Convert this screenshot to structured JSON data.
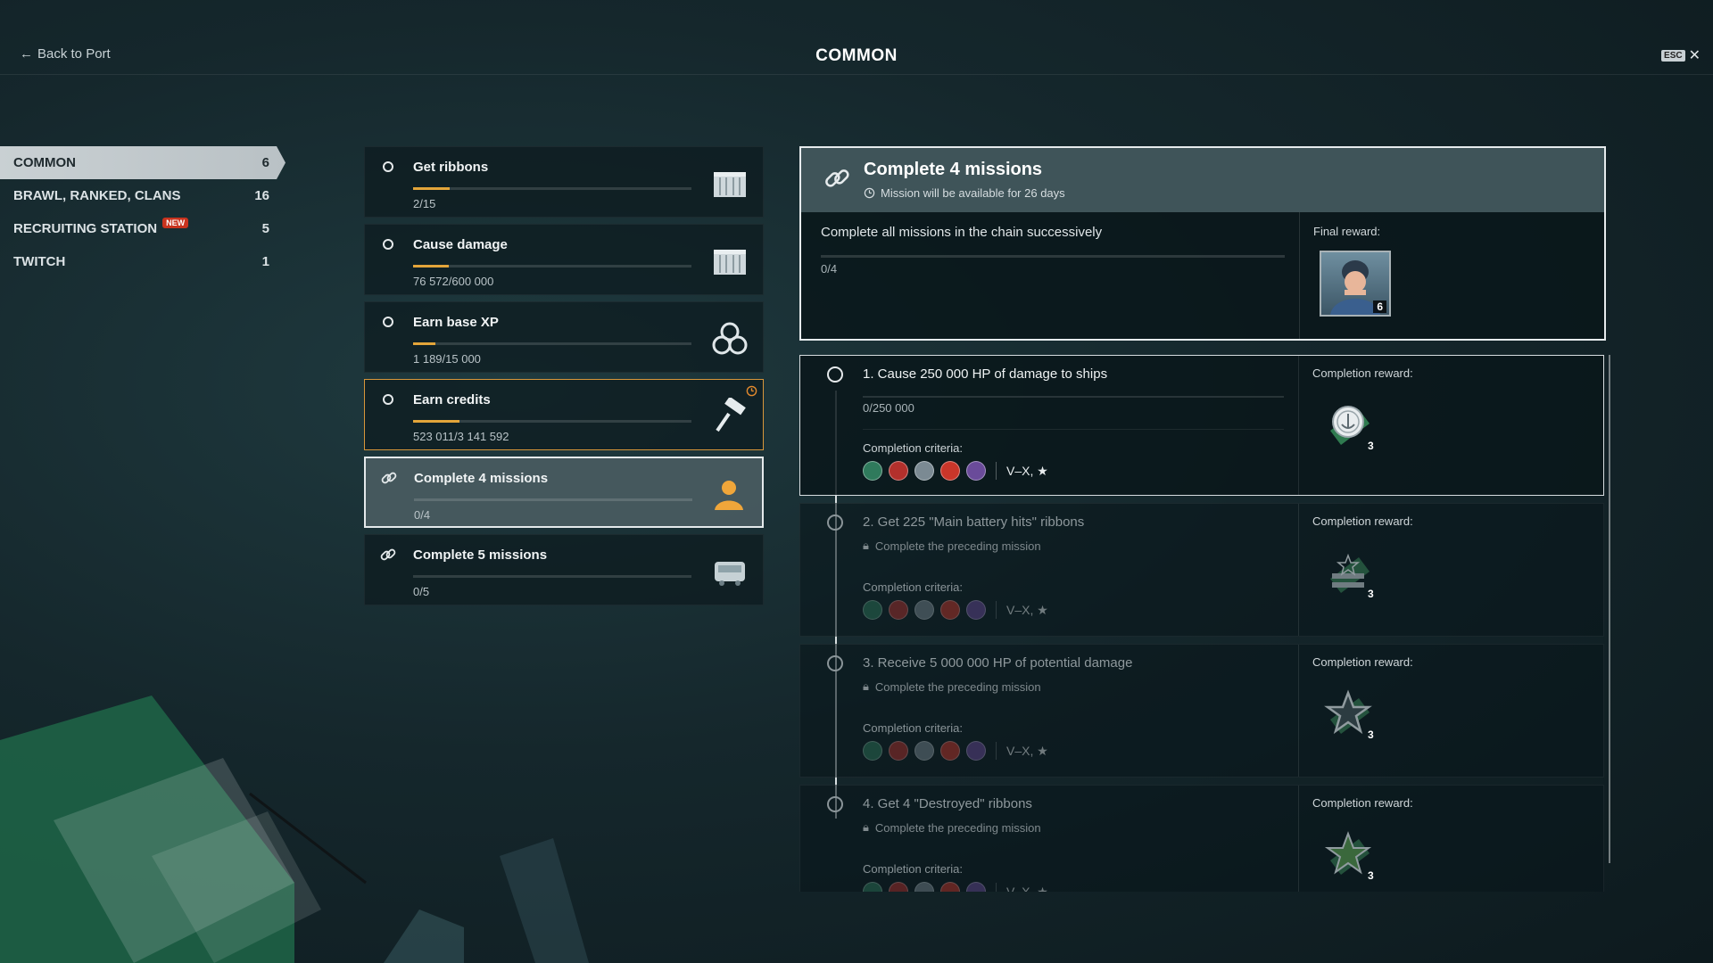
{
  "header": {
    "back_label": "Back to Port",
    "title": "COMMON",
    "esc_label": "ESC",
    "close_glyph": "✕"
  },
  "categories": [
    {
      "label": "COMMON",
      "count": "6",
      "active": true
    },
    {
      "label": "BRAWL, RANKED, CLANS",
      "count": "16"
    },
    {
      "label": "RECRUITING STATION",
      "count": "5",
      "badge": "NEW"
    },
    {
      "label": "TWITCH",
      "count": "1"
    }
  ],
  "missions": [
    {
      "title": "Get ribbons",
      "progress_text": "2/15",
      "progress": 0.133,
      "icon": "container-icon"
    },
    {
      "title": "Cause damage",
      "progress_text": "76 572/600 000",
      "progress": 0.128,
      "icon": "container-icon"
    },
    {
      "title": "Earn base XP",
      "progress_text": "1 189/15 000",
      "progress": 0.079,
      "icon": "signal-flags-icon"
    },
    {
      "title": "Earn credits",
      "progress_text": "523 011/3 141 592",
      "progress": 0.166,
      "icon": "camouflage-roller-icon",
      "timer": true
    },
    {
      "title": "Complete 4 missions",
      "progress_text": "0/4",
      "progress": 0,
      "icon": "commander-icon",
      "chain": true,
      "selected": true
    },
    {
      "title": "Complete 5 missions",
      "progress_text": "0/5",
      "progress": 0,
      "icon": "supply-crate-icon",
      "chain": true
    }
  ],
  "detail": {
    "title": "Complete 4 missions",
    "availability": "Mission will be available for 26 days",
    "description": "Complete all missions in the chain successively",
    "progress_text": "0/4",
    "final_reward_label": "Final reward:",
    "final_reward_count": "6",
    "steps": [
      {
        "title": "1. Cause 250 000 HP of damage to ships",
        "progress_text": "0/250 000",
        "reward_label": "Completion reward:",
        "criteria_label": "Completion criteria:",
        "tiers": "V–X, ★",
        "reward_count": "3",
        "reward_icon": "anchor-token-icon"
      },
      {
        "title": "2. Get 225 \"Main battery hits\" ribbons",
        "lock_text": "Complete the preceding mission",
        "reward_label": "Completion reward:",
        "criteria_label": "Completion criteria:",
        "tiers": "V–X, ★",
        "reward_count": "3",
        "reward_icon": "star-stripe-token-icon"
      },
      {
        "title": "3. Receive 5 000 000 HP of potential damage",
        "lock_text": "Complete the preceding mission",
        "reward_label": "Completion reward:",
        "criteria_label": "Completion criteria:",
        "tiers": "V–X, ★",
        "reward_count": "3",
        "reward_icon": "star-outline-token-icon"
      },
      {
        "title": "4. Get 4 \"Destroyed\" ribbons",
        "lock_text": "Complete the preceding mission",
        "reward_label": "Completion reward:",
        "criteria_label": "Completion criteria:",
        "tiers": "V–X, ★",
        "reward_count": "3",
        "reward_icon": "star-green-token-icon"
      }
    ]
  },
  "colors": {
    "accent": "#e3a53a",
    "panel": "#3f5459",
    "credits_border": "#d8963a",
    "new_badge": "#c8331e"
  }
}
